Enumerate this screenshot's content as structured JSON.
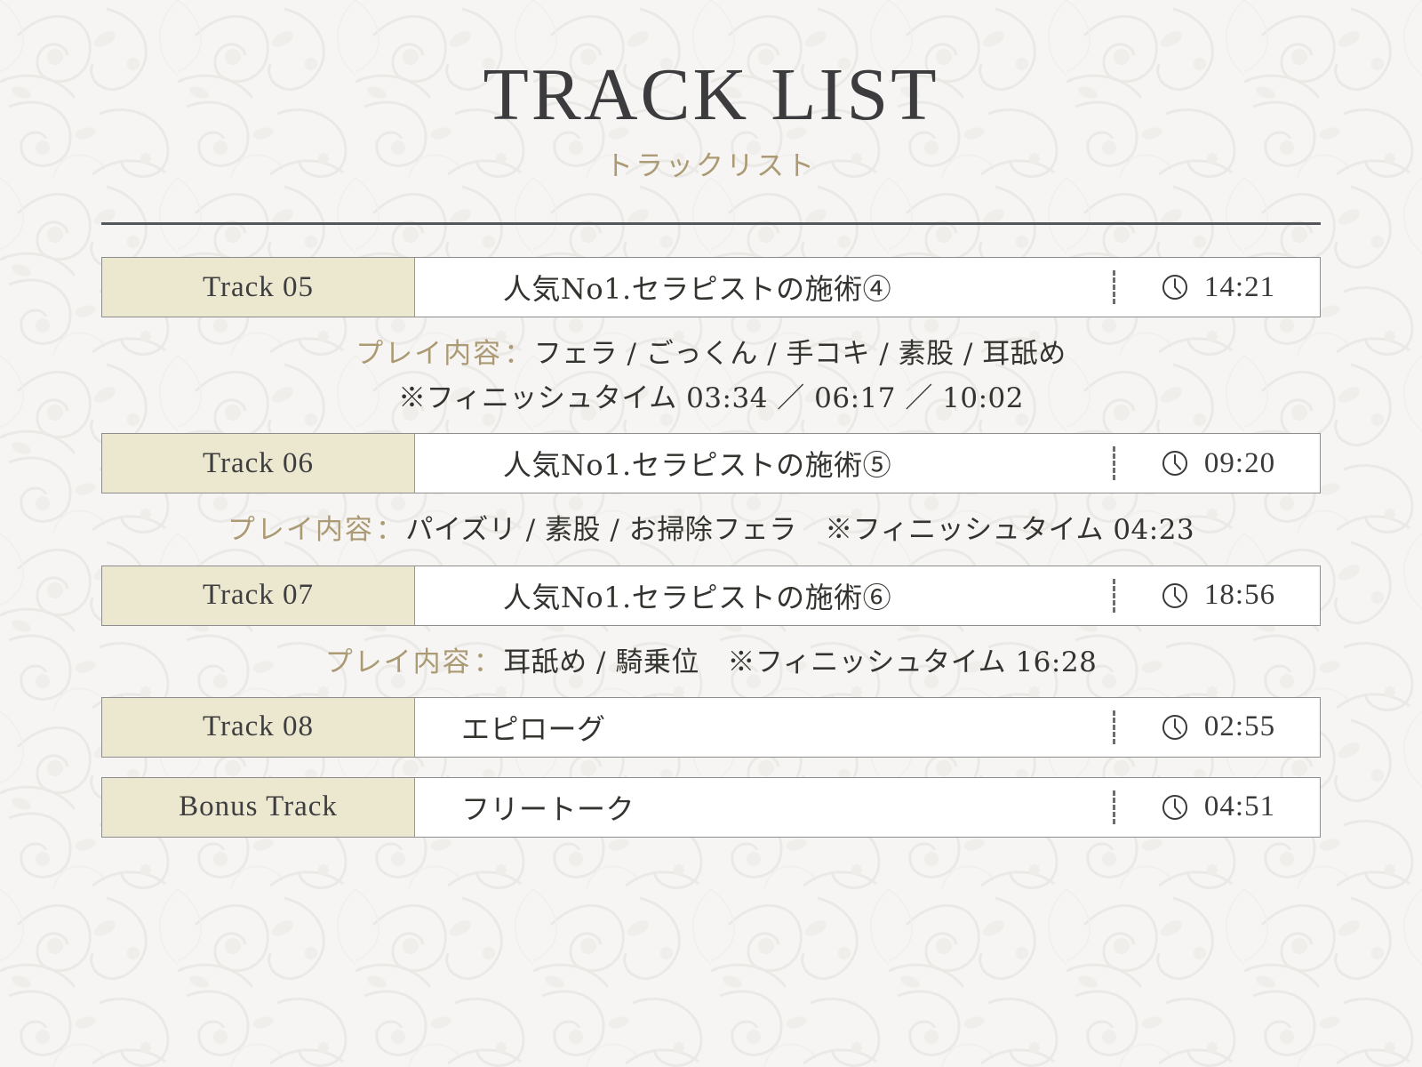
{
  "header": {
    "title": "TRACK LIST",
    "subtitle": "トラックリスト"
  },
  "colors": {
    "background": "#f6f5f3",
    "badge_fill": "#ece7cf",
    "accent_gold": "#ab9a73",
    "text_dark": "#33332f",
    "rule": "#55565a",
    "row_border": "#8d8d8d"
  },
  "icons": {
    "clock": "clock-icon"
  },
  "tracks": [
    {
      "badge": "Track 05",
      "title": "人気No1.セラピストの施術④",
      "title_align": "center",
      "duration": "14:21",
      "play_label": "プレイ内容",
      "colon": "：",
      "play_lines": [
        "フェラ / ごっくん / 手コキ / 素股 / 耳舐め",
        "※フィニッシュタイム 03:34 ／ 06:17 ／ 10:02"
      ]
    },
    {
      "badge": "Track 06",
      "title": "人気No1.セラピストの施術⑤",
      "title_align": "center",
      "duration": "09:20",
      "play_label": "プレイ内容",
      "colon": "：",
      "play_lines": [
        "パイズリ / 素股 / お掃除フェラ　※フィニッシュタイム 04:23"
      ]
    },
    {
      "badge": "Track 07",
      "title": "人気No1.セラピストの施術⑥",
      "title_align": "center",
      "duration": "18:56",
      "play_label": "プレイ内容",
      "colon": "：",
      "play_lines": [
        "耳舐め / 騎乗位　※フィニッシュタイム 16:28"
      ]
    },
    {
      "badge": "Track 08",
      "title": "エピローグ",
      "title_align": "left",
      "duration": "02:55",
      "play_label": "",
      "colon": "",
      "play_lines": []
    },
    {
      "badge": "Bonus Track",
      "title": "フリートーク",
      "title_align": "left",
      "duration": "04:51",
      "play_label": "",
      "colon": "",
      "play_lines": []
    }
  ]
}
